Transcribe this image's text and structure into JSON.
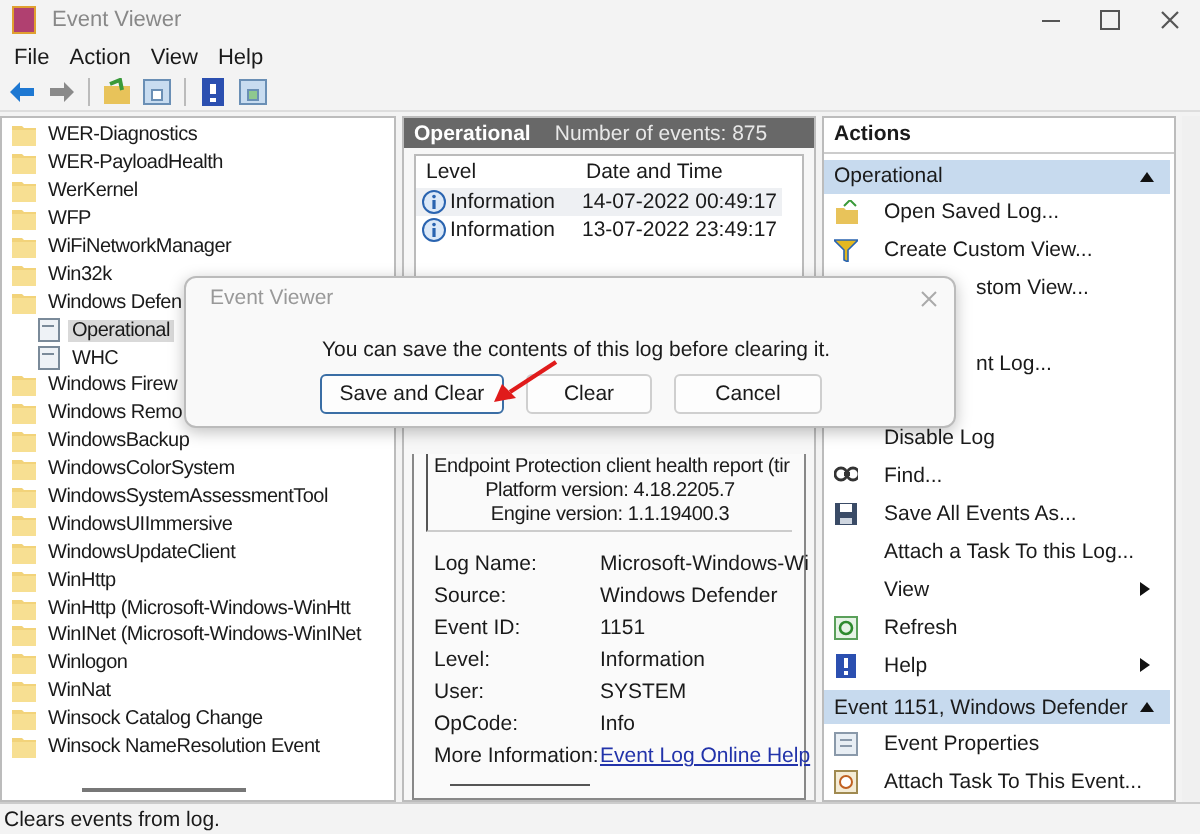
{
  "window": {
    "title": "Event Viewer"
  },
  "menu": [
    "File",
    "Action",
    "View",
    "Help"
  ],
  "tree": {
    "items": [
      {
        "label": "WER-Diagnostics",
        "kind": "folder",
        "selected": false
      },
      {
        "label": "WER-PayloadHealth",
        "kind": "folder",
        "selected": false
      },
      {
        "label": "WerKernel",
        "kind": "folder",
        "selected": false
      },
      {
        "label": "WFP",
        "kind": "folder",
        "selected": false
      },
      {
        "label": "WiFiNetworkManager",
        "kind": "folder",
        "selected": false
      },
      {
        "label": "Win32k",
        "kind": "folder",
        "selected": false
      },
      {
        "label": "Windows Defen",
        "kind": "folder",
        "selected": false,
        "children": [
          {
            "label": "Operational",
            "kind": "log",
            "selected": true
          },
          {
            "label": "WHC",
            "kind": "log",
            "selected": false
          }
        ]
      },
      {
        "label": "Windows Firew",
        "kind": "folder",
        "selected": false
      },
      {
        "label": "Windows Remo",
        "kind": "folder",
        "selected": false
      },
      {
        "label": "WindowsBackup",
        "kind": "folder",
        "selected": false
      },
      {
        "label": "WindowsColorSystem",
        "kind": "folder",
        "selected": false
      },
      {
        "label": "WindowsSystemAssessmentTool",
        "kind": "folder",
        "selected": false
      },
      {
        "label": "WindowsUIImmersive",
        "kind": "folder",
        "selected": false
      },
      {
        "label": "WindowsUpdateClient",
        "kind": "folder",
        "selected": false
      },
      {
        "label": "WinHttp",
        "kind": "folder",
        "selected": false
      },
      {
        "label": "WinHttp (Microsoft-Windows-WinHtt",
        "kind": "folder",
        "selected": false
      },
      {
        "label": "WinINet (Microsoft-Windows-WinINet",
        "kind": "folder",
        "selected": false
      },
      {
        "label": "Winlogon",
        "kind": "folder",
        "selected": false
      },
      {
        "label": "WinNat",
        "kind": "folder",
        "selected": false
      },
      {
        "label": "Winsock Catalog Change",
        "kind": "folder",
        "selected": false
      },
      {
        "label": "Winsock NameResolution Event",
        "kind": "folder",
        "selected": false
      }
    ]
  },
  "log": {
    "title": "Operational",
    "count": "Number of events: 875",
    "columns": [
      "Level",
      "Date and Time"
    ],
    "rows": [
      {
        "level": "Information",
        "time": "14-07-2022 00:49:17",
        "selected": true
      },
      {
        "level": "Information",
        "time": "13-07-2022 23:49:17",
        "selected": false
      }
    ],
    "description": [
      "Endpoint Protection client health report (tir",
      "Platform version: 4.18.2205.7",
      "Engine version: 1.1.19400.3"
    ],
    "fields": [
      {
        "label": "Log Name:",
        "value": "Microsoft-Windows-Wi",
        "kind": "text"
      },
      {
        "label": "Source:",
        "value": "Windows Defender",
        "kind": "text"
      },
      {
        "label": "Event ID:",
        "value": "1151",
        "kind": "text"
      },
      {
        "label": "Level:",
        "value": "Information",
        "kind": "text"
      },
      {
        "label": "User:",
        "value": "SYSTEM",
        "kind": "text"
      },
      {
        "label": "OpCode:",
        "value": "Info",
        "kind": "text"
      },
      {
        "label": "More Information:",
        "value": "Event Log Online Help",
        "kind": "link"
      }
    ]
  },
  "actions": {
    "title": "Actions",
    "sections": [
      {
        "title": "Operational",
        "expanded": true,
        "items": [
          {
            "label": "Open Saved Log...",
            "kind": "open",
            "submenu": false
          },
          {
            "label": "Create Custom View...",
            "kind": "filter",
            "submenu": false
          },
          {
            "label": "stom View...",
            "kind": "cut",
            "submenu": false
          },
          {
            "kind": "hidden",
            "submenu": false
          },
          {
            "label": "nt Log...",
            "kind": "cut",
            "submenu": false
          },
          {
            "kind": "hidden",
            "submenu": false
          },
          {
            "label": "Disable Log",
            "kind": "plain",
            "submenu": false
          },
          {
            "label": "Find...",
            "kind": "find",
            "submenu": false
          },
          {
            "label": "Save All Events As...",
            "kind": "save",
            "submenu": false
          },
          {
            "label": "Attach a Task To this Log...",
            "kind": "plain",
            "submenu": false
          },
          {
            "label": "View",
            "kind": "plain",
            "submenu": true
          },
          {
            "label": "Refresh",
            "kind": "refresh",
            "submenu": false
          },
          {
            "label": "Help",
            "kind": "help",
            "submenu": true
          }
        ]
      },
      {
        "title": "Event 1151, Windows Defender",
        "expanded": true,
        "items": [
          {
            "label": "Event Properties",
            "kind": "properties",
            "submenu": false
          },
          {
            "label": "Attach Task To This Event...",
            "kind": "task",
            "submenu": false
          }
        ]
      }
    ]
  },
  "dialog": {
    "title": "Event Viewer",
    "message": "You can save the contents of this log before clearing it.",
    "buttons": [
      {
        "label": "Save and Clear",
        "focused": true
      },
      {
        "label": "Clear",
        "focused": false
      },
      {
        "label": "Cancel",
        "focused": false
      }
    ]
  },
  "status_bar": "Clears events from log."
}
